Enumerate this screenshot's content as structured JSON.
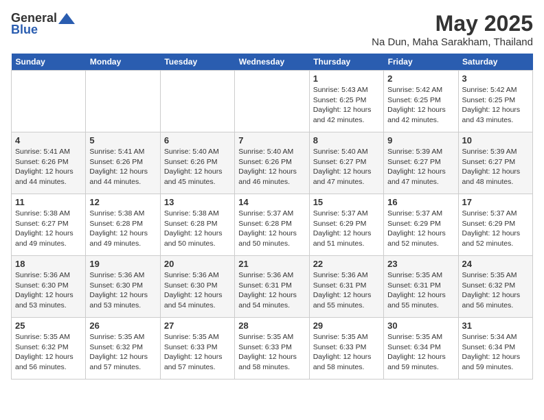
{
  "header": {
    "logo_general": "General",
    "logo_blue": "Blue",
    "month": "May 2025",
    "location": "Na Dun, Maha Sarakham, Thailand"
  },
  "days_of_week": [
    "Sunday",
    "Monday",
    "Tuesday",
    "Wednesday",
    "Thursday",
    "Friday",
    "Saturday"
  ],
  "weeks": [
    [
      {
        "day": "",
        "sunrise": "",
        "sunset": "",
        "daylight": ""
      },
      {
        "day": "",
        "sunrise": "",
        "sunset": "",
        "daylight": ""
      },
      {
        "day": "",
        "sunrise": "",
        "sunset": "",
        "daylight": ""
      },
      {
        "day": "",
        "sunrise": "",
        "sunset": "",
        "daylight": ""
      },
      {
        "day": "1",
        "sunrise": "Sunrise: 5:43 AM",
        "sunset": "Sunset: 6:25 PM",
        "daylight": "Daylight: 12 hours and 42 minutes."
      },
      {
        "day": "2",
        "sunrise": "Sunrise: 5:42 AM",
        "sunset": "Sunset: 6:25 PM",
        "daylight": "Daylight: 12 hours and 42 minutes."
      },
      {
        "day": "3",
        "sunrise": "Sunrise: 5:42 AM",
        "sunset": "Sunset: 6:25 PM",
        "daylight": "Daylight: 12 hours and 43 minutes."
      }
    ],
    [
      {
        "day": "4",
        "sunrise": "Sunrise: 5:41 AM",
        "sunset": "Sunset: 6:26 PM",
        "daylight": "Daylight: 12 hours and 44 minutes."
      },
      {
        "day": "5",
        "sunrise": "Sunrise: 5:41 AM",
        "sunset": "Sunset: 6:26 PM",
        "daylight": "Daylight: 12 hours and 44 minutes."
      },
      {
        "day": "6",
        "sunrise": "Sunrise: 5:40 AM",
        "sunset": "Sunset: 6:26 PM",
        "daylight": "Daylight: 12 hours and 45 minutes."
      },
      {
        "day": "7",
        "sunrise": "Sunrise: 5:40 AM",
        "sunset": "Sunset: 6:26 PM",
        "daylight": "Daylight: 12 hours and 46 minutes."
      },
      {
        "day": "8",
        "sunrise": "Sunrise: 5:40 AM",
        "sunset": "Sunset: 6:27 PM",
        "daylight": "Daylight: 12 hours and 47 minutes."
      },
      {
        "day": "9",
        "sunrise": "Sunrise: 5:39 AM",
        "sunset": "Sunset: 6:27 PM",
        "daylight": "Daylight: 12 hours and 47 minutes."
      },
      {
        "day": "10",
        "sunrise": "Sunrise: 5:39 AM",
        "sunset": "Sunset: 6:27 PM",
        "daylight": "Daylight: 12 hours and 48 minutes."
      }
    ],
    [
      {
        "day": "11",
        "sunrise": "Sunrise: 5:38 AM",
        "sunset": "Sunset: 6:27 PM",
        "daylight": "Daylight: 12 hours and 49 minutes."
      },
      {
        "day": "12",
        "sunrise": "Sunrise: 5:38 AM",
        "sunset": "Sunset: 6:28 PM",
        "daylight": "Daylight: 12 hours and 49 minutes."
      },
      {
        "day": "13",
        "sunrise": "Sunrise: 5:38 AM",
        "sunset": "Sunset: 6:28 PM",
        "daylight": "Daylight: 12 hours and 50 minutes."
      },
      {
        "day": "14",
        "sunrise": "Sunrise: 5:37 AM",
        "sunset": "Sunset: 6:28 PM",
        "daylight": "Daylight: 12 hours and 50 minutes."
      },
      {
        "day": "15",
        "sunrise": "Sunrise: 5:37 AM",
        "sunset": "Sunset: 6:29 PM",
        "daylight": "Daylight: 12 hours and 51 minutes."
      },
      {
        "day": "16",
        "sunrise": "Sunrise: 5:37 AM",
        "sunset": "Sunset: 6:29 PM",
        "daylight": "Daylight: 12 hours and 52 minutes."
      },
      {
        "day": "17",
        "sunrise": "Sunrise: 5:37 AM",
        "sunset": "Sunset: 6:29 PM",
        "daylight": "Daylight: 12 hours and 52 minutes."
      }
    ],
    [
      {
        "day": "18",
        "sunrise": "Sunrise: 5:36 AM",
        "sunset": "Sunset: 6:30 PM",
        "daylight": "Daylight: 12 hours and 53 minutes."
      },
      {
        "day": "19",
        "sunrise": "Sunrise: 5:36 AM",
        "sunset": "Sunset: 6:30 PM",
        "daylight": "Daylight: 12 hours and 53 minutes."
      },
      {
        "day": "20",
        "sunrise": "Sunrise: 5:36 AM",
        "sunset": "Sunset: 6:30 PM",
        "daylight": "Daylight: 12 hours and 54 minutes."
      },
      {
        "day": "21",
        "sunrise": "Sunrise: 5:36 AM",
        "sunset": "Sunset: 6:31 PM",
        "daylight": "Daylight: 12 hours and 54 minutes."
      },
      {
        "day": "22",
        "sunrise": "Sunrise: 5:36 AM",
        "sunset": "Sunset: 6:31 PM",
        "daylight": "Daylight: 12 hours and 55 minutes."
      },
      {
        "day": "23",
        "sunrise": "Sunrise: 5:35 AM",
        "sunset": "Sunset: 6:31 PM",
        "daylight": "Daylight: 12 hours and 55 minutes."
      },
      {
        "day": "24",
        "sunrise": "Sunrise: 5:35 AM",
        "sunset": "Sunset: 6:32 PM",
        "daylight": "Daylight: 12 hours and 56 minutes."
      }
    ],
    [
      {
        "day": "25",
        "sunrise": "Sunrise: 5:35 AM",
        "sunset": "Sunset: 6:32 PM",
        "daylight": "Daylight: 12 hours and 56 minutes."
      },
      {
        "day": "26",
        "sunrise": "Sunrise: 5:35 AM",
        "sunset": "Sunset: 6:32 PM",
        "daylight": "Daylight: 12 hours and 57 minutes."
      },
      {
        "day": "27",
        "sunrise": "Sunrise: 5:35 AM",
        "sunset": "Sunset: 6:33 PM",
        "daylight": "Daylight: 12 hours and 57 minutes."
      },
      {
        "day": "28",
        "sunrise": "Sunrise: 5:35 AM",
        "sunset": "Sunset: 6:33 PM",
        "daylight": "Daylight: 12 hours and 58 minutes."
      },
      {
        "day": "29",
        "sunrise": "Sunrise: 5:35 AM",
        "sunset": "Sunset: 6:33 PM",
        "daylight": "Daylight: 12 hours and 58 minutes."
      },
      {
        "day": "30",
        "sunrise": "Sunrise: 5:35 AM",
        "sunset": "Sunset: 6:34 PM",
        "daylight": "Daylight: 12 hours and 59 minutes."
      },
      {
        "day": "31",
        "sunrise": "Sunrise: 5:34 AM",
        "sunset": "Sunset: 6:34 PM",
        "daylight": "Daylight: 12 hours and 59 minutes."
      }
    ]
  ]
}
